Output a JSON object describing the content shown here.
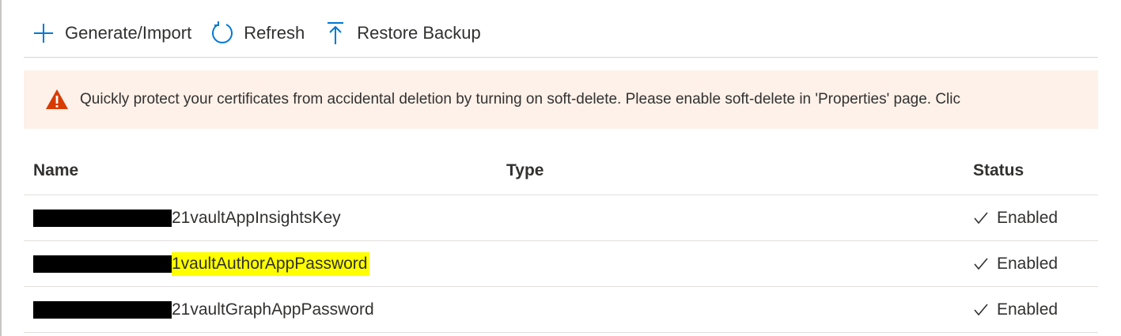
{
  "toolbar": {
    "generate_label": "Generate/Import",
    "refresh_label": "Refresh",
    "restore_label": "Restore Backup"
  },
  "banner": {
    "text": "Quickly protect your certificates from accidental deletion by turning on soft-delete. Please enable soft-delete in 'Properties' page. Clic",
    "icon": "warning-icon",
    "background_color": "#fdf1e9",
    "icon_color": "#d83b01"
  },
  "table": {
    "columns": {
      "name": "Name",
      "type": "Type",
      "status": "Status"
    },
    "rows": [
      {
        "name": "21vaultAppInsightsKey",
        "type": "",
        "status": "Enabled",
        "highlighted": false
      },
      {
        "name": "1vaultAuthorAppPassword",
        "type": "",
        "status": "Enabled",
        "highlighted": true
      },
      {
        "name": "21vaultGraphAppPassword",
        "type": "",
        "status": "Enabled",
        "highlighted": false
      }
    ]
  },
  "colors": {
    "accent": "#0078d4",
    "highlight": "#ffff00"
  }
}
